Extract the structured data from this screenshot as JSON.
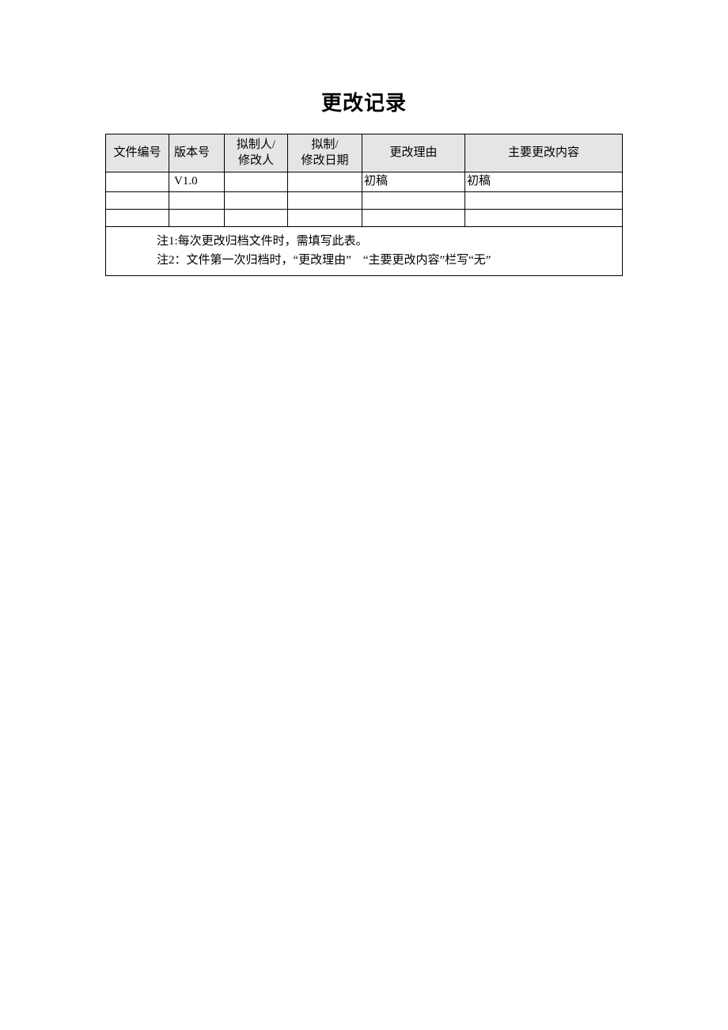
{
  "title": "更改记录",
  "headers": {
    "c1": "文件编号",
    "c2": "版本号",
    "c3_l1": "拟制人/",
    "c3_l2": "修改人",
    "c4_l1": "拟制/",
    "c4_l2": "修改日期",
    "c5": "更改理由",
    "c6": "主要更改内容"
  },
  "rows": [
    {
      "c1": "",
      "c2": "V1.0",
      "c3": "",
      "c4": "",
      "c5": "初稿",
      "c6": "初稿"
    },
    {
      "c1": "",
      "c2": "",
      "c3": "",
      "c4": "",
      "c5": "",
      "c6": ""
    },
    {
      "c1": "",
      "c2": "",
      "c3": "",
      "c4": "",
      "c5": "",
      "c6": ""
    }
  ],
  "notes": {
    "n1": "注1:每次更改归档文件时，需填写此表。",
    "n2": "注2：文件第一次归档时，“更改理由”　“主要更改内容”栏写“无”"
  }
}
